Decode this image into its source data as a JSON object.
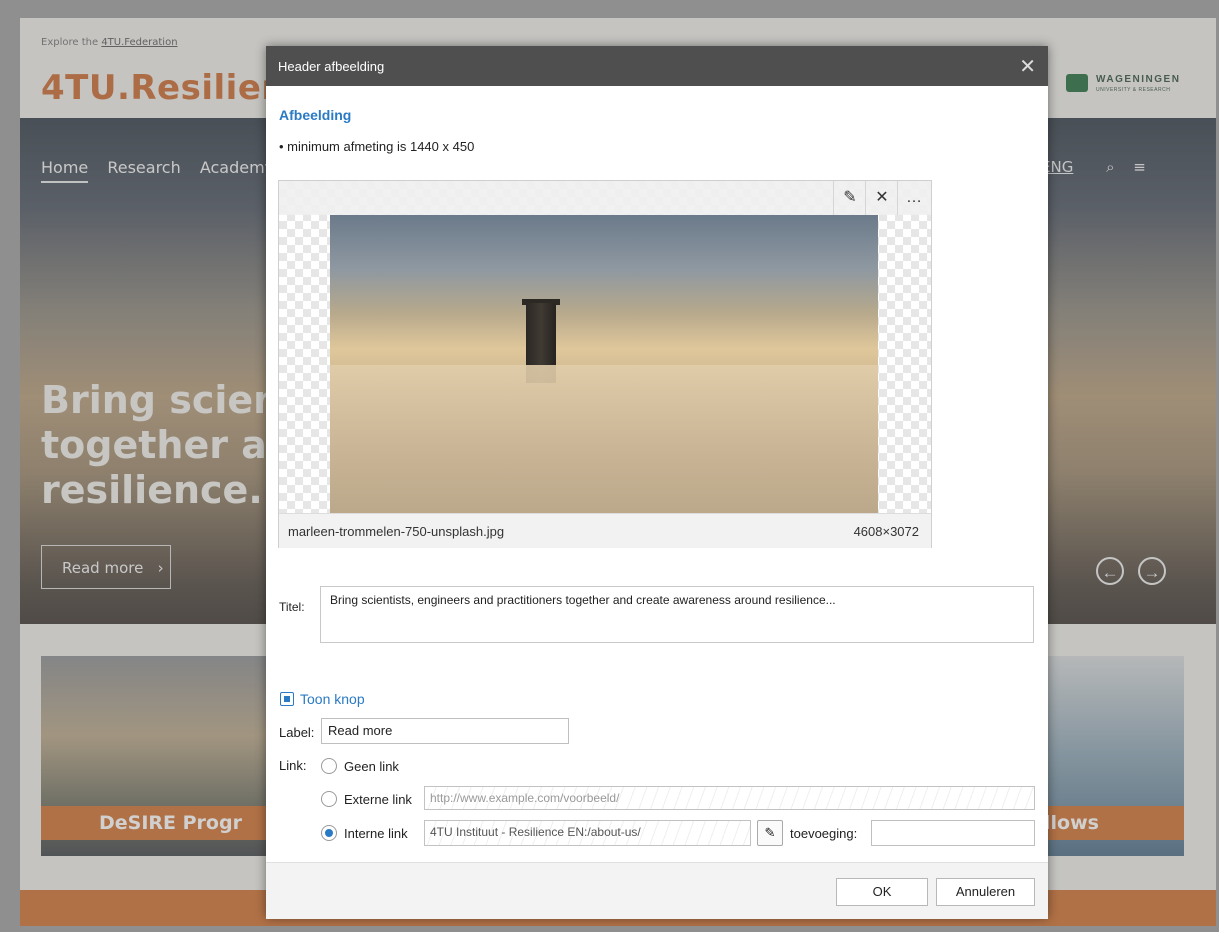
{
  "site": {
    "explore_prefix": "Explore the",
    "explore_link": "4TU.Federation",
    "logo_prefix": "4TU.",
    "logo_name": "Resilien",
    "nav": [
      "Home",
      "Research",
      "Academy"
    ],
    "lang": "ENG",
    "partner_logo_text": "WAGENINGEN",
    "partner_logo_sub": "UNIVERSITY & RESEARCH",
    "hero_lines": [
      "Bring scienti",
      "together and",
      "resilience..."
    ],
    "read_more": "Read more",
    "card_left": "DeSIRE Progr",
    "card_right": "llows"
  },
  "dialog": {
    "title": "Header afbeelding",
    "section": "Afbeelding",
    "min_size_note": "• minimum afmeting is 1440 x 450",
    "image": {
      "filename": "marleen-trommelen-750-unsplash.jpg",
      "dimensions": "4608×3072"
    },
    "titel_label": "Titel:",
    "titel_value": "Bring scientists, engineers and practitioners together and create awareness around resilience...",
    "show_button_label": "Toon knop",
    "label_label": "Label:",
    "label_value": "Read more",
    "link_label": "Link:",
    "link_options": {
      "none": "Geen link",
      "external": "Externe link",
      "internal": "Interne link"
    },
    "external_placeholder": "http://www.example.com/voorbeeld/",
    "internal_value": "4TU Instituut - Resilience EN:/about-us/",
    "addition_label": "toevoeging:",
    "ok": "OK",
    "cancel": "Annuleren"
  }
}
